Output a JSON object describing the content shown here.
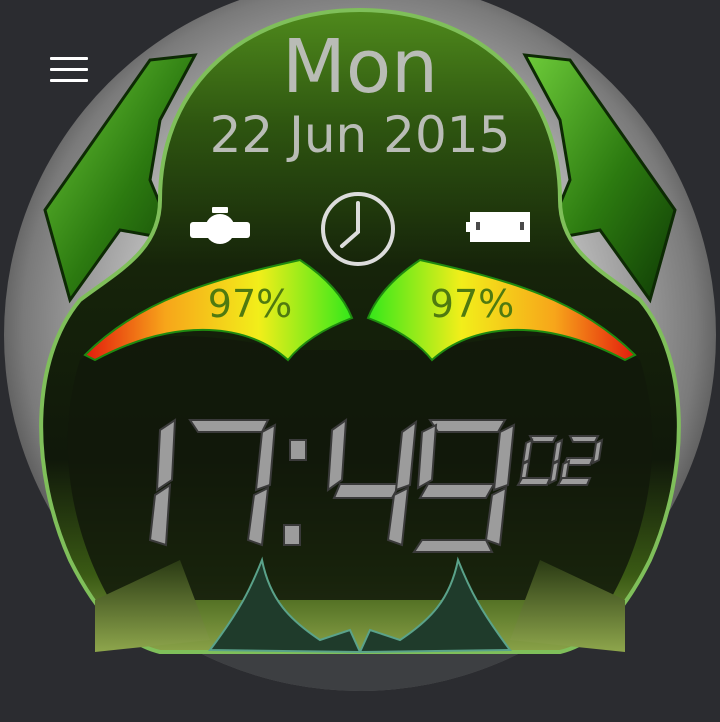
{
  "menu": {
    "icon": "hamburger-menu-icon"
  },
  "watch_face": {
    "day": "Mon",
    "date": "22 Jun 2015",
    "icons": {
      "watch_battery": "watch-icon",
      "clock": "clock-icon",
      "phone_battery": "phone-battery-icon"
    },
    "left_gauge": {
      "percent_text": "97%",
      "value": 97
    },
    "right_gauge": {
      "percent_text": "97%",
      "value": 97
    },
    "time": {
      "hour": "17",
      "minute": "49",
      "seconds": "02"
    },
    "colors": {
      "body_green": "#3f6b1a",
      "dark_face": "#141a0c",
      "digit_gray": "#9c9c9c",
      "gauge_red": "#e31b0c",
      "gauge_yellow": "#f2ee1a",
      "gauge_green": "#33e81a",
      "text_gray": "#b9bcb6"
    }
  }
}
